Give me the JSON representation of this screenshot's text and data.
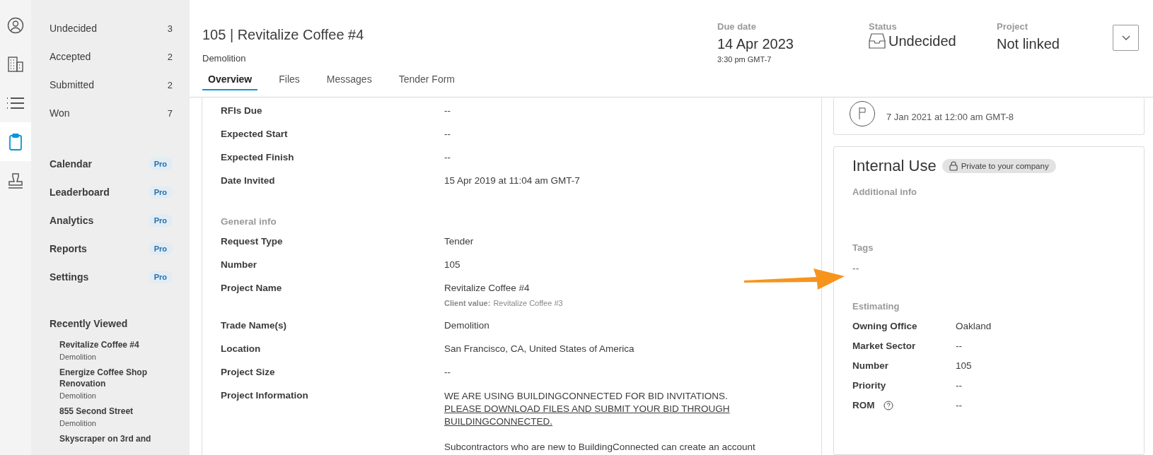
{
  "rail": [
    {
      "kind": "person",
      "selected": false
    },
    {
      "kind": "building",
      "selected": false
    },
    {
      "kind": "list",
      "selected": false
    },
    {
      "kind": "clipboard",
      "selected": true
    },
    {
      "kind": "stamp",
      "selected": false
    }
  ],
  "sidebar": {
    "status_items": [
      {
        "label": "Undecided",
        "count": "3"
      },
      {
        "label": "Accepted",
        "count": "2"
      },
      {
        "label": "Submitted",
        "count": "2"
      },
      {
        "label": "Won",
        "count": "7"
      }
    ],
    "features": [
      {
        "label": "Calendar",
        "badge": "Pro"
      },
      {
        "label": "Leaderboard",
        "badge": "Pro"
      },
      {
        "label": "Analytics",
        "badge": "Pro"
      },
      {
        "label": "Reports",
        "badge": "Pro"
      },
      {
        "label": "Settings",
        "badge": "Pro"
      }
    ],
    "recently_viewed": {
      "title": "Recently Viewed",
      "items": [
        {
          "name": "Revitalize Coffee #4",
          "trade": "Demolition"
        },
        {
          "name": "Energize Coffee Shop Renovation",
          "trade": "Demolition"
        },
        {
          "name": "855 Second Street",
          "trade": "Demolition"
        },
        {
          "name": "Skyscraper on 3rd and"
        }
      ]
    }
  },
  "header": {
    "title": "105 | Revitalize Coffee #4",
    "subtitle": "Demolition",
    "tabs": [
      {
        "label": "Overview",
        "selected": true
      },
      {
        "label": "Files",
        "selected": false
      },
      {
        "label": "Messages",
        "selected": false
      },
      {
        "label": "Tender Form",
        "selected": false
      }
    ],
    "due": {
      "label": "Due date",
      "date": "14 Apr 2023",
      "time": "3:30 pm GMT-7"
    },
    "status": {
      "label": "Status",
      "value": "Undecided"
    },
    "project": {
      "label": "Project",
      "value": "Not linked"
    }
  },
  "details": [
    {
      "kind": "field",
      "label": "RFIs Due",
      "value": "--"
    },
    {
      "kind": "field",
      "label": "Expected Start",
      "value": "--"
    },
    {
      "kind": "field",
      "label": "Expected Finish",
      "value": "--"
    },
    {
      "kind": "field",
      "label": "Date Invited",
      "value": "15 Apr 2019 at 11:04 am GMT-7"
    },
    {
      "kind": "section",
      "label": "General info"
    },
    {
      "kind": "field",
      "label": "Request Type",
      "value": "Tender"
    },
    {
      "kind": "field",
      "label": "Number",
      "value": "105"
    },
    {
      "kind": "field",
      "label": "Project Name",
      "value": "Revitalize Coffee #4",
      "client_label": "Client value:",
      "client_value": "Revitalize Coffee #3"
    },
    {
      "kind": "field",
      "label": "Trade Name(s)",
      "value": "Demolition"
    },
    {
      "kind": "field",
      "label": "Location",
      "value": "San Francisco, CA, United States of America"
    },
    {
      "kind": "field",
      "label": "Project Size",
      "value": "--"
    },
    {
      "kind": "info",
      "label": "Project Information",
      "value": "WE ARE USING BUILDINGCONNECTED FOR BID INVITATIONS.",
      "link": "PLEASE DOWNLOAD FILES AND SUBMIT YOUR BID THROUGH BUILDINGCONNECTED.",
      "note": "Subcontractors who are new to BuildingConnected can create an account"
    }
  ],
  "activity": {
    "time": "7 Jan 2021 at 12:00 am GMT-8"
  },
  "internal": {
    "title": "Internal Use",
    "badge": "Private to your company",
    "additional_info_label": "Additional info",
    "tags_label": "Tags",
    "tags_value": "--",
    "estimating_label": "Estimating",
    "rows": [
      {
        "label": "Owning Office",
        "value": "Oakland",
        "help": false
      },
      {
        "label": "Market Sector",
        "value": "--",
        "help": false
      },
      {
        "label": "Number",
        "value": "105",
        "help": false
      },
      {
        "label": "Priority",
        "value": "--",
        "help": false
      },
      {
        "label": "ROM",
        "value": "--",
        "help": true
      }
    ]
  }
}
